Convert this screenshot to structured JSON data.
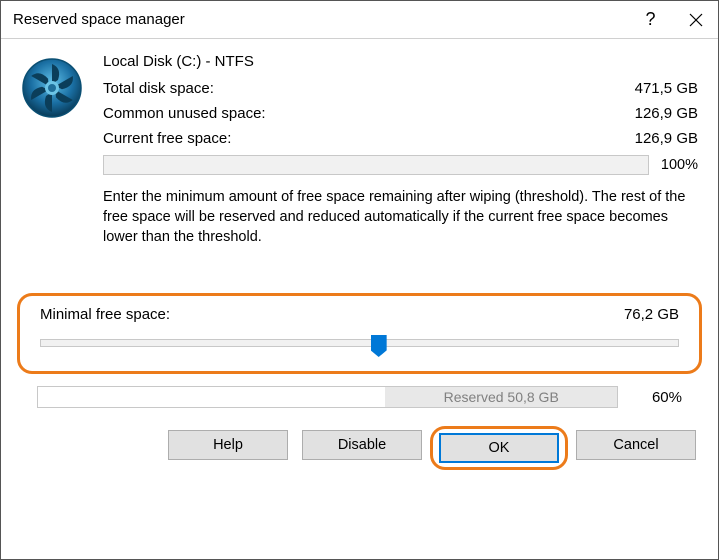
{
  "titlebar": {
    "title": "Reserved space manager"
  },
  "drive": {
    "name": "Local Disk (C:) - NTFS",
    "total_label": "Total disk space:",
    "total_value": "471,5 GB",
    "unused_label": "Common unused space:",
    "unused_value": "126,9 GB",
    "free_label": "Current free space:",
    "free_value": "126,9 GB",
    "free_pct": "100%"
  },
  "description": "Enter the minimum amount of free space remaining after wiping (threshold). The rest of the free space will be reserved and reduced automatically if the current free space becomes lower than the threshold.",
  "slider": {
    "label": "Minimal free space:",
    "value": "76,2 GB",
    "percent": 53
  },
  "reserved": {
    "label": "Reserved 50,8 GB",
    "fill_pct": 40,
    "pct_text": "60%"
  },
  "buttons": {
    "help": "Help",
    "disable": "Disable",
    "ok": "OK",
    "cancel": "Cancel"
  }
}
